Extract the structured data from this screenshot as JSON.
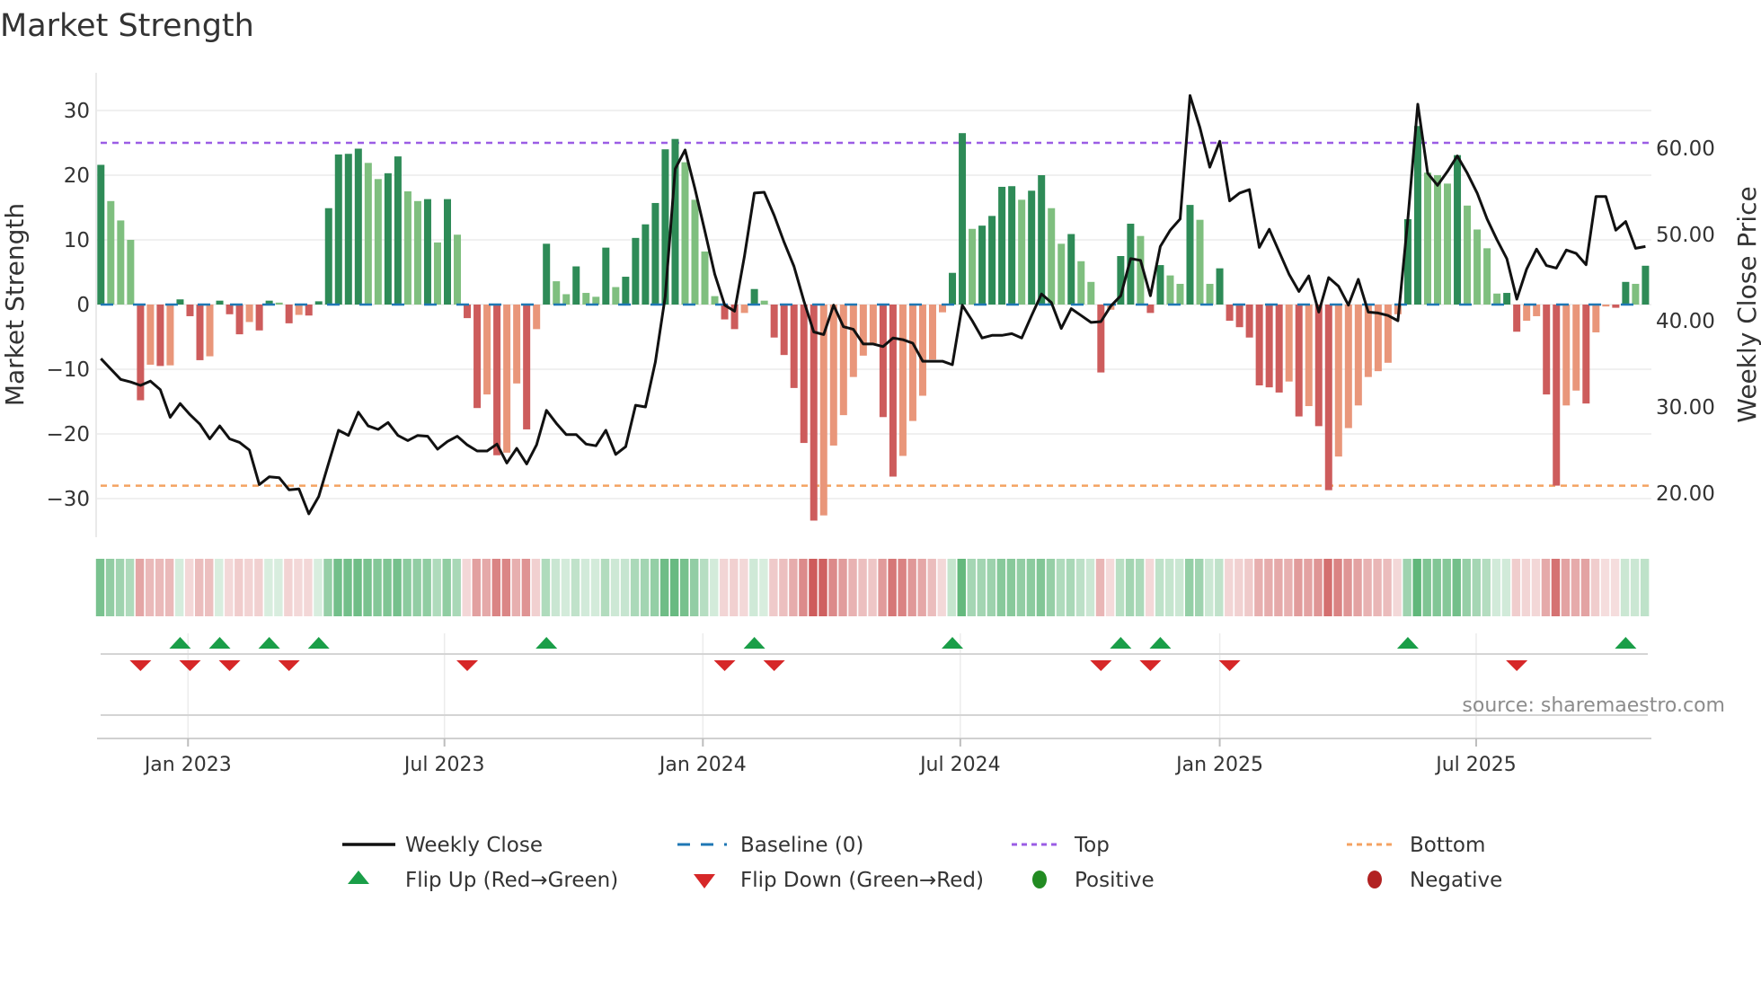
{
  "title": "Market Strength",
  "colors": {
    "bar_pos_rising": "#2e8b57",
    "bar_pos_falling": "#7fbf7f",
    "bar_neg_falling": "#cd5c5c",
    "bar_neg_rising": "#e9967a",
    "price_line": "#111111",
    "baseline": "#1f77b4",
    "top": "#9b5de5",
    "bottom": "#f4a261",
    "flip_up": "#1a9e48",
    "flip_down": "#d62728",
    "positive": "#228b22",
    "negative": "#b22222",
    "grid": "#ebebeb"
  },
  "source": "source: sharemaestro.com",
  "legend": {
    "weekly_close": "Weekly Close",
    "baseline": "Baseline (0)",
    "top": "Top",
    "bottom": "Bottom",
    "flip_up": "Flip Up (Red→Green)",
    "flip_down": "Flip Down (Green→Red)",
    "positive": "Positive",
    "negative": "Negative"
  },
  "chart_data": {
    "type": "bar",
    "title": "Market Strength",
    "ylabel": "Market Strength",
    "y2label": "Weekly Close Price",
    "xlabel": "",
    "ylim": [
      -36,
      36
    ],
    "y2lim": [
      14.9,
      68.75
    ],
    "y_ticks": [
      30,
      20,
      10,
      0,
      -10,
      -20,
      -30
    ],
    "y_tick_labels": [
      "30",
      "20",
      "10",
      "0",
      "−10",
      "−20",
      "−30"
    ],
    "y2_ticks": [
      60,
      50,
      40,
      30,
      20
    ],
    "y2_tick_labels": [
      "60.00",
      "50.00",
      "40.00",
      "30.00",
      "20.00"
    ],
    "x_tick_labels": [
      "Jan 2023",
      "Jul 2023",
      "Jan 2024",
      "Jul 2024",
      "Jan 2025",
      "Jul 2025"
    ],
    "x_tick_week_index": [
      8.8,
      34.7,
      60.8,
      86.8,
      113,
      138.9
    ],
    "grid": true,
    "legend_position": "bottom",
    "top_threshold": 25,
    "bottom_threshold": -28,
    "baseline": 0,
    "series": [
      {
        "name": "Market Strength",
        "type": "bar",
        "values": [
          21.6,
          16,
          13,
          10,
          -14.8,
          -9.3,
          -9.5,
          -9.4,
          0.8,
          -1.8,
          -8.6,
          -8,
          0.6,
          -1.5,
          -4.6,
          -2.7,
          -4,
          0.6,
          0.3,
          -2.9,
          -1.6,
          -1.7,
          0.5,
          14.9,
          23.2,
          23.3,
          24.1,
          21.9,
          19.4,
          20.3,
          22.9,
          17.5,
          16,
          16.3,
          9.6,
          16.3,
          10.8,
          -2.1,
          -16,
          -13.9,
          -23.3,
          -22.9,
          -12.2,
          -19.3,
          -3.8,
          9.4,
          3.6,
          1.6,
          5.9,
          1.8,
          1.2,
          8.8,
          2.7,
          4.3,
          10.3,
          12.4,
          15.7,
          24,
          25.6,
          22,
          16.2,
          8.2,
          1.3,
          -2.3,
          -3.8,
          -1.3,
          2.4,
          0.6,
          -5.1,
          -7.8,
          -12.9,
          -21.4,
          -33.4,
          -32.6,
          -21.8,
          -17.1,
          -11.2,
          -7.9,
          -6,
          -17.4,
          -26.6,
          -23.4,
          -18,
          -14.1,
          -8.5,
          -1.2,
          4.9,
          26.5,
          11.7,
          12.2,
          13.7,
          18.2,
          18.3,
          16.2,
          17.6,
          20,
          14.9,
          9.4,
          10.9,
          6.7,
          3.5,
          -10.5,
          -0.8,
          7.5,
          12.5,
          10.6,
          -1.3,
          6.1,
          4.5,
          3.2,
          15.4,
          13.1,
          3.2,
          5.6,
          -2.5,
          -3.5,
          -5.1,
          -12.5,
          -12.8,
          -13.6,
          -11.9,
          -17.3,
          -15.7,
          -18.8,
          -28.7,
          -23.5,
          -19.1,
          -15.6,
          -11.2,
          -10.3,
          -9,
          -1.5,
          13.2,
          27.6,
          20.4,
          20,
          18.7,
          23.1,
          15.3,
          11.6,
          8.7,
          1.7,
          1.8,
          -4.2,
          -2.5,
          -1.8,
          -13.9,
          -28,
          -15.6,
          -13.3,
          -15.3,
          -4.3,
          -0.3,
          -0.5,
          3.5,
          3.2,
          6
        ]
      },
      {
        "name": "Weekly Close",
        "type": "line",
        "axis": "right",
        "values": [
          35.6,
          34.4,
          33.2,
          32.9,
          32.5,
          33.0,
          32.0,
          28.8,
          30.4,
          29.1,
          28.0,
          26.3,
          27.8,
          26.3,
          25.9,
          25.0,
          21.0,
          21.9,
          21.8,
          20.4,
          20.5,
          17.6,
          19.6,
          23.5,
          27.3,
          26.7,
          29.4,
          27.8,
          27.4,
          28.2,
          26.7,
          26.1,
          26.7,
          26.6,
          25.1,
          26.0,
          26.6,
          25.6,
          24.9,
          24.9,
          25.7,
          23.5,
          25.2,
          23.4,
          25.6,
          29.6,
          28.1,
          26.8,
          26.8,
          25.7,
          25.5,
          27.3,
          24.5,
          25.4,
          30.2,
          30.0,
          35.2,
          42.8,
          57.6,
          59.8,
          55.3,
          50.4,
          45.4,
          41.8,
          41.1,
          47.5,
          54.8,
          54.9,
          52.2,
          49.1,
          46.3,
          42.3,
          38.7,
          38.4,
          41.8,
          39.3,
          39.0,
          37.3,
          37.3,
          37.0,
          38.0,
          37.8,
          37.4,
          35.3,
          35.3,
          35.3,
          34.9,
          41.8,
          40.0,
          38.0,
          38.3,
          38.3,
          38.5,
          38.0,
          40.6,
          43.1,
          42.1,
          39.1,
          41.4,
          40.6,
          39.8,
          39.9,
          41.7,
          42.9,
          47.2,
          47.0,
          42.9,
          48.6,
          50.5,
          51.8,
          66.1,
          62.4,
          57.8,
          60.8,
          53.9,
          54.8,
          55.2,
          48.5,
          50.6,
          48.0,
          45.4,
          43.4,
          45.2,
          41.0,
          45.0,
          44.0,
          41.8,
          44.8,
          41.0,
          40.9,
          40.6,
          40.0,
          51.7,
          65.1,
          57.1,
          55.7,
          57.3,
          59.1,
          57.1,
          54.8,
          51.8,
          49.4,
          47.2,
          42.5,
          46.0,
          48.3,
          46.4,
          46.1,
          48.2,
          47.8,
          46.5,
          54.4,
          54.4,
          50.5,
          51.5,
          48.4,
          48.6
        ]
      }
    ],
    "flip_up_week_index": [
      8,
      12,
      17,
      22,
      45,
      66,
      86,
      103,
      107,
      132,
      154
    ],
    "flip_down_week_index": [
      4,
      9,
      13,
      19,
      37,
      63,
      68,
      101,
      106,
      114,
      143
    ]
  }
}
